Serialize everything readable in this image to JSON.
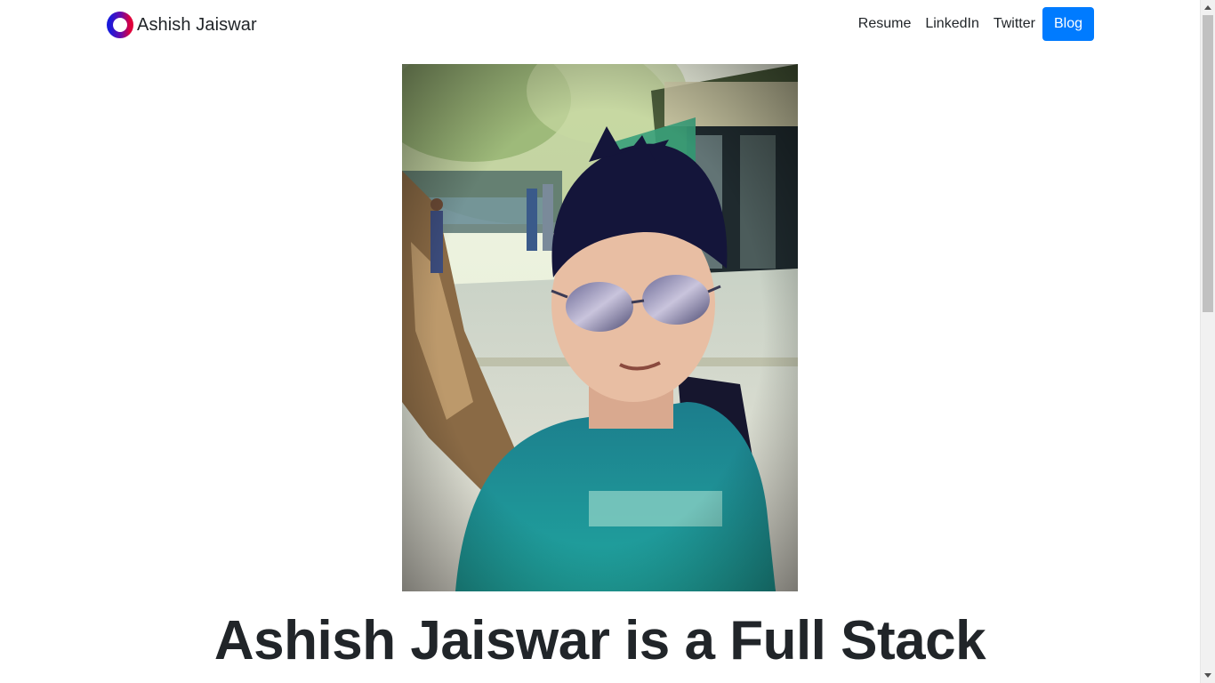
{
  "navbar": {
    "brand_name": "Ashish Jaiswar",
    "brand_logo_icon": "ring-logo-icon",
    "links": {
      "resume": "Resume",
      "linkedin": "LinkedIn",
      "twitter": "Twitter",
      "blog": "Blog"
    }
  },
  "hero": {
    "photo_icon": "profile-photo",
    "headline": "Ashish Jaiswar is a Full Stack"
  },
  "colors": {
    "accent": "#007bff",
    "text": "#212529",
    "logo_gradient_start": "#1a1adb",
    "logo_gradient_end": "#e0003a"
  }
}
